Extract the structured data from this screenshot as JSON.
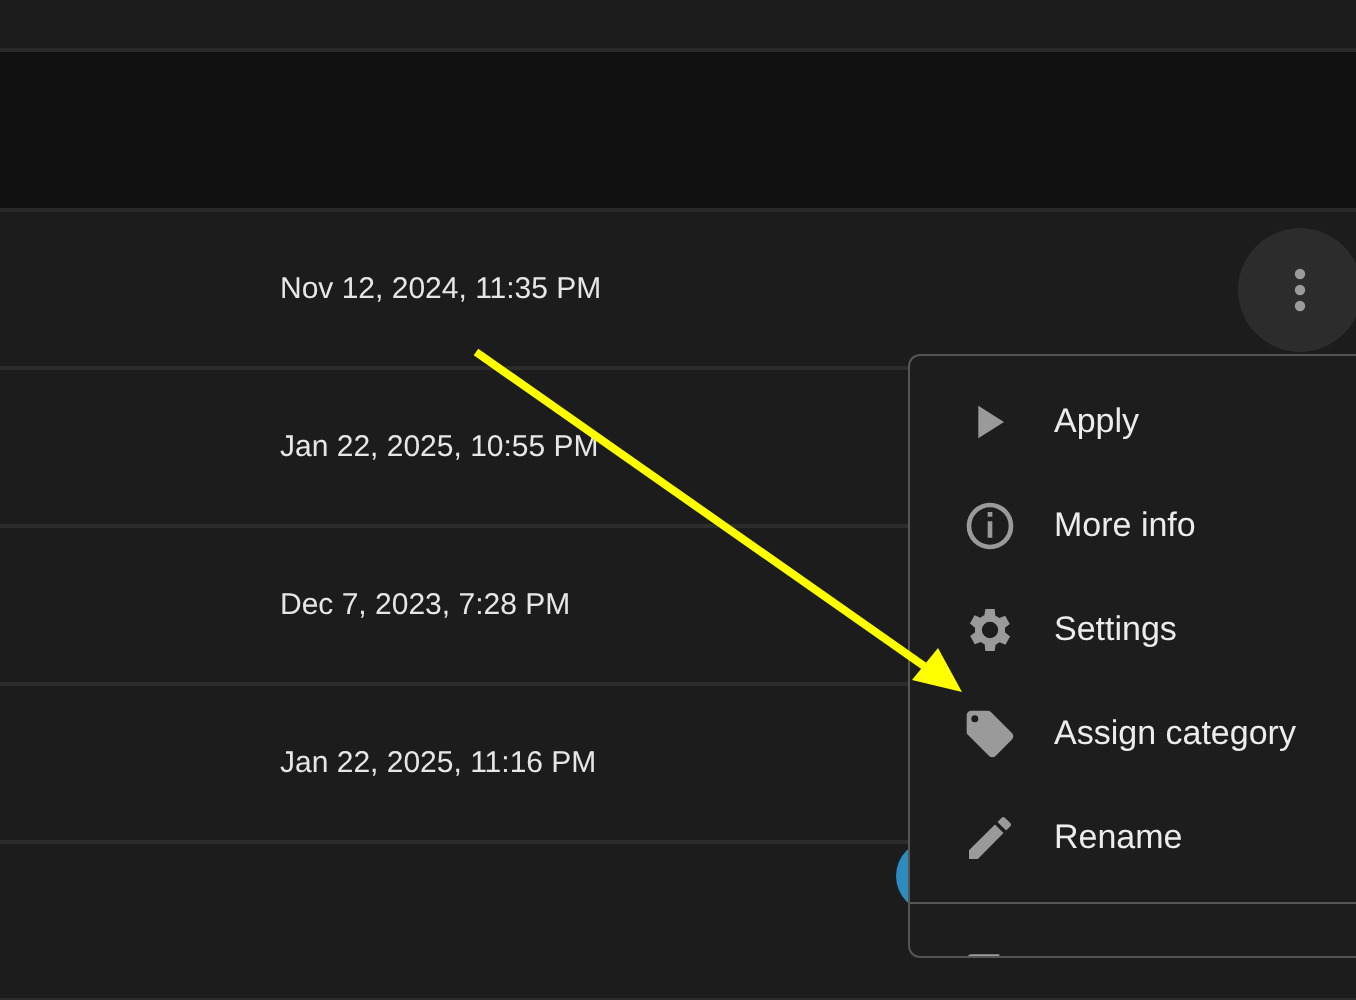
{
  "rows": [
    {
      "date": "Nov 12, 2024, 11:35 PM",
      "menu_open": true
    },
    {
      "date": "Jan 22, 2025, 10:55 PM",
      "menu_open": false
    },
    {
      "date": "Dec 7, 2023, 7:28 PM",
      "menu_open": false
    },
    {
      "date": "Jan 22, 2025, 11:16 PM",
      "menu_open": false
    },
    {
      "menu_open": false
    }
  ],
  "menu": {
    "items": [
      {
        "label": "Apply"
      },
      {
        "label": "More info"
      },
      {
        "label": "Settings"
      },
      {
        "label": "Assign category"
      },
      {
        "label": "Rename"
      }
    ]
  }
}
